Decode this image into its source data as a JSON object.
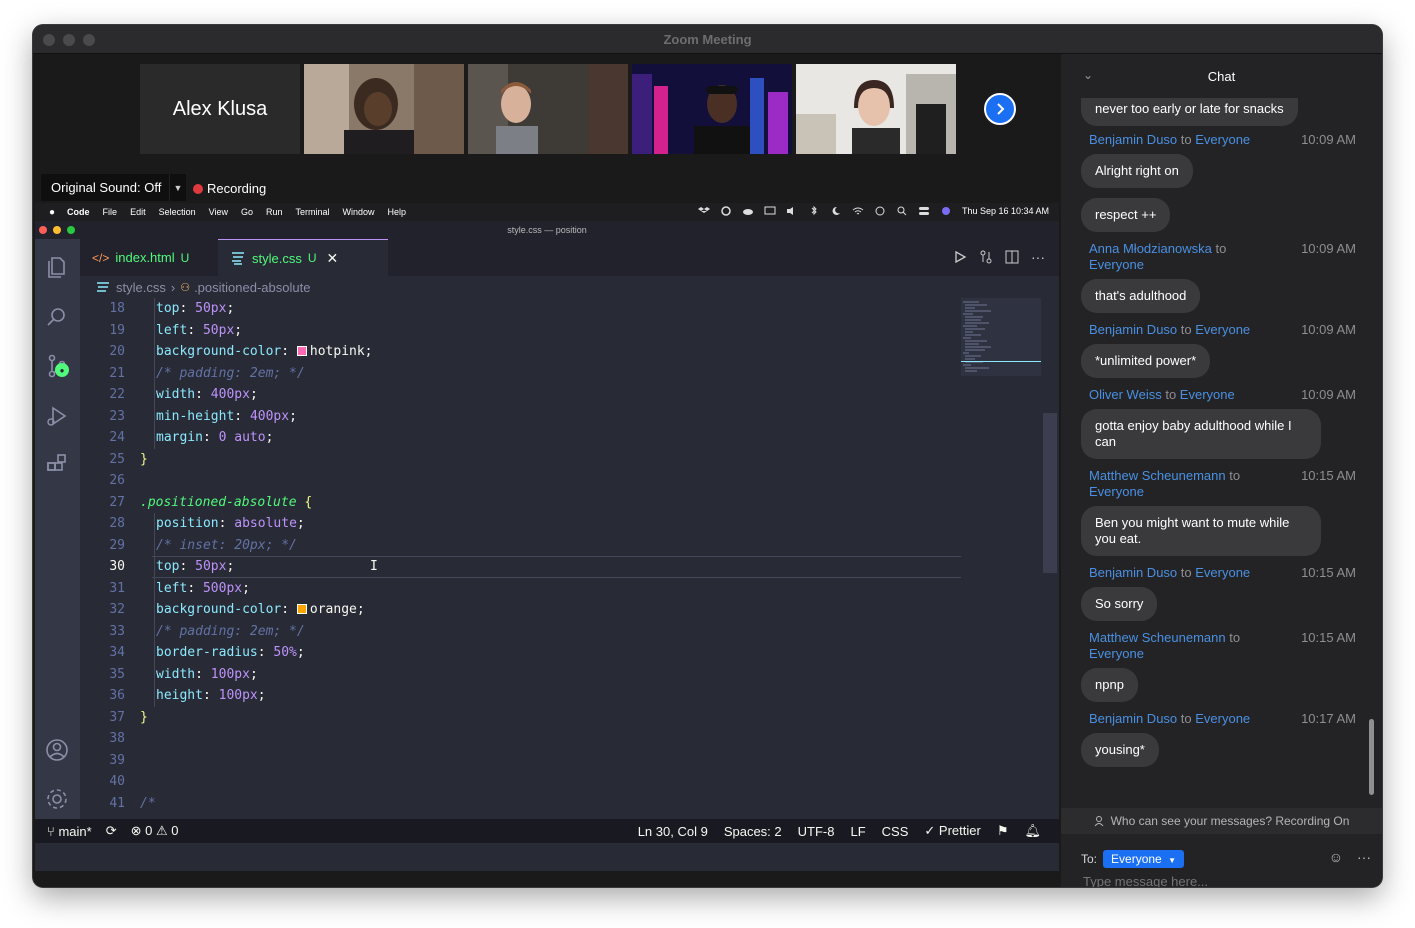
{
  "window": {
    "title": "Zoom Meeting"
  },
  "gallery": {
    "name_tile": "Alex Klusa",
    "original_sound": "Original Sound: Off",
    "recording": "Recording"
  },
  "mac_menu": {
    "items": [
      "Code",
      "File",
      "Edit",
      "Selection",
      "View",
      "Go",
      "Run",
      "Terminal",
      "Window",
      "Help"
    ],
    "clock": "Thu Sep 16  10:34 AM"
  },
  "vscode": {
    "window_title": "style.css — position",
    "tabs": [
      {
        "label": "index.html",
        "status": "U"
      },
      {
        "label": "style.css",
        "status": "U"
      }
    ],
    "breadcrumb": {
      "file": "style.css",
      "symbol": ".positioned-absolute"
    },
    "lines": [
      {
        "n": "18",
        "tokens": [
          [
            "prop",
            "top"
          ],
          [
            "p",
            ": "
          ],
          [
            "num",
            "50px"
          ],
          [
            "p",
            ";"
          ]
        ]
      },
      {
        "n": "19",
        "tokens": [
          [
            "prop",
            "left"
          ],
          [
            "p",
            ": "
          ],
          [
            "num",
            "50px"
          ],
          [
            "p",
            ";"
          ]
        ]
      },
      {
        "n": "20",
        "tokens": [
          [
            "prop",
            "background-color"
          ],
          [
            "p",
            ": "
          ],
          [
            "swatch",
            "#ff69b4"
          ],
          [
            "p",
            "hotpink;"
          ]
        ]
      },
      {
        "n": "21",
        "tokens": [
          [
            "cm",
            "/* padding: 2em; */"
          ]
        ]
      },
      {
        "n": "22",
        "tokens": [
          [
            "prop",
            "width"
          ],
          [
            "p",
            ": "
          ],
          [
            "num",
            "400px"
          ],
          [
            "p",
            ";"
          ]
        ]
      },
      {
        "n": "23",
        "tokens": [
          [
            "prop",
            "min-height"
          ],
          [
            "p",
            ": "
          ],
          [
            "num",
            "400px"
          ],
          [
            "p",
            ";"
          ]
        ]
      },
      {
        "n": "24",
        "tokens": [
          [
            "prop",
            "margin"
          ],
          [
            "p",
            ": "
          ],
          [
            "num",
            "0"
          ],
          [
            "p",
            " "
          ],
          [
            "kw",
            "auto"
          ],
          [
            "p",
            ";"
          ]
        ]
      },
      {
        "n": "25",
        "tokens": [
          [
            "brace",
            "}"
          ]
        ],
        "outdent": true
      },
      {
        "n": "26",
        "tokens": []
      },
      {
        "n": "27",
        "tokens": [
          [
            "sel",
            ".positioned-absolute"
          ],
          [
            "p",
            " "
          ],
          [
            "brace",
            "{"
          ]
        ],
        "outdent": true
      },
      {
        "n": "28",
        "tokens": [
          [
            "prop",
            "position"
          ],
          [
            "p",
            ": "
          ],
          [
            "kw",
            "absolute"
          ],
          [
            "p",
            ";"
          ]
        ]
      },
      {
        "n": "29",
        "tokens": [
          [
            "cm",
            "/* inset: 20px; */"
          ]
        ]
      },
      {
        "n": "30",
        "tokens": [
          [
            "prop",
            "top"
          ],
          [
            "p",
            ": "
          ],
          [
            "num",
            "50px"
          ],
          [
            "p",
            ";"
          ]
        ],
        "active": true
      },
      {
        "n": "31",
        "tokens": [
          [
            "prop",
            "left"
          ],
          [
            "p",
            ": "
          ],
          [
            "num",
            "500px"
          ],
          [
            "p",
            ";"
          ]
        ]
      },
      {
        "n": "32",
        "tokens": [
          [
            "prop",
            "background-color"
          ],
          [
            "p",
            ": "
          ],
          [
            "swatch",
            "#ffa500"
          ],
          [
            "p",
            "orange;"
          ]
        ]
      },
      {
        "n": "33",
        "tokens": [
          [
            "cm",
            "/* padding: 2em; */"
          ]
        ]
      },
      {
        "n": "34",
        "tokens": [
          [
            "prop",
            "border-radius"
          ],
          [
            "p",
            ": "
          ],
          [
            "num",
            "50%"
          ],
          [
            "p",
            ";"
          ]
        ]
      },
      {
        "n": "35",
        "tokens": [
          [
            "prop",
            "width"
          ],
          [
            "p",
            ": "
          ],
          [
            "num",
            "100px"
          ],
          [
            "p",
            ";"
          ]
        ]
      },
      {
        "n": "36",
        "tokens": [
          [
            "prop",
            "height"
          ],
          [
            "p",
            ": "
          ],
          [
            "num",
            "100px"
          ],
          [
            "p",
            ";"
          ]
        ]
      },
      {
        "n": "37",
        "tokens": [
          [
            "brace",
            "}"
          ]
        ],
        "outdent": true
      },
      {
        "n": "38",
        "tokens": []
      },
      {
        "n": "39",
        "tokens": []
      },
      {
        "n": "40",
        "tokens": []
      },
      {
        "n": "41",
        "tokens": [
          [
            "cm",
            "/*"
          ]
        ],
        "outdent": true
      }
    ],
    "status": {
      "branch": "main*",
      "errors": "0",
      "warnings": "0",
      "position": "Ln 30, Col 9",
      "spaces": "Spaces: 2",
      "encoding": "UTF-8",
      "eol": "LF",
      "language": "CSS",
      "formatter": "Prettier"
    }
  },
  "chat": {
    "title": "Chat",
    "messages": [
      {
        "sender": "",
        "to": "",
        "recipient": "",
        "time": "",
        "text": "never too early or late for snacks"
      },
      {
        "sender": "Benjamin Duso",
        "to": "to",
        "recipient": "Everyone",
        "time": "10:09 AM",
        "text": "Alright right on"
      },
      {
        "sender": "",
        "to": "",
        "recipient": "",
        "time": "",
        "text": "respect ++"
      },
      {
        "sender": "Anna Młodzianowska",
        "to": "to",
        "recipient": "Everyone",
        "time": "10:09 AM",
        "text": "that's adulthood"
      },
      {
        "sender": "Benjamin Duso",
        "to": "to",
        "recipient": "Everyone",
        "time": "10:09 AM",
        "text": "*unlimited power*"
      },
      {
        "sender": "Oliver Weiss",
        "to": "to",
        "recipient": "Everyone",
        "time": "10:09 AM",
        "text": "gotta enjoy baby adulthood while I can"
      },
      {
        "sender": "Matthew Scheunemann",
        "to": "to",
        "recipient": "Everyone",
        "time": "10:15 AM",
        "text": "Ben you might want to mute while you eat."
      },
      {
        "sender": "Benjamin Duso",
        "to": "to",
        "recipient": "Everyone",
        "time": "10:15 AM",
        "text": "So sorry"
      },
      {
        "sender": "Matthew Scheunemann",
        "to": "to",
        "recipient": "Everyone",
        "time": "10:15 AM",
        "text": "npnp"
      },
      {
        "sender": "Benjamin Duso",
        "to": "to",
        "recipient": "Everyone",
        "time": "10:17 AM",
        "text": "yousing*"
      }
    ],
    "privacy": "Who can see your messages? Recording On",
    "to_label": "To:",
    "recipient_select": "Everyone",
    "input_placeholder": "Type message here..."
  }
}
